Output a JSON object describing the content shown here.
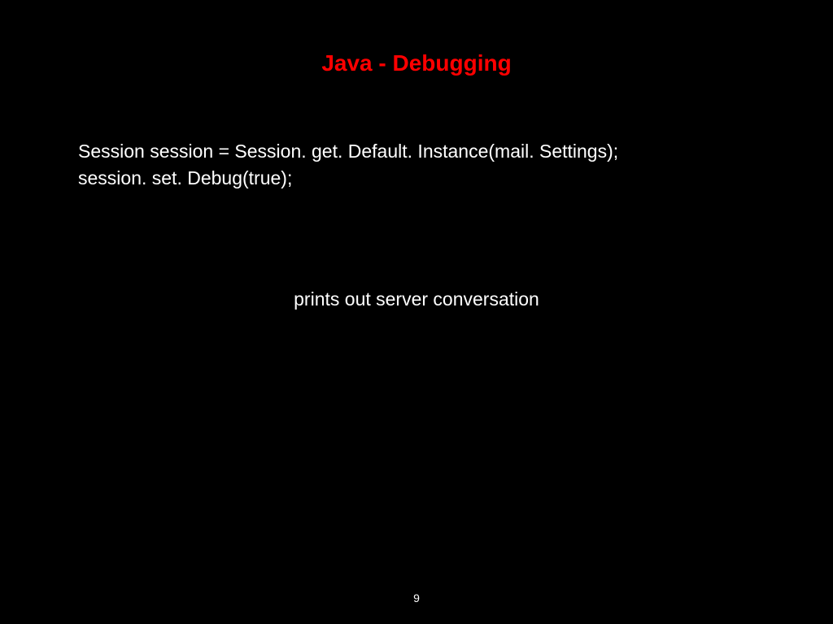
{
  "slide": {
    "title": "Java - Debugging",
    "code_line1": "Session session = Session. get. Default. Instance(mail. Settings);",
    "code_line2": "session. set. Debug(true);",
    "description": "prints out server conversation",
    "page_number": "9"
  }
}
